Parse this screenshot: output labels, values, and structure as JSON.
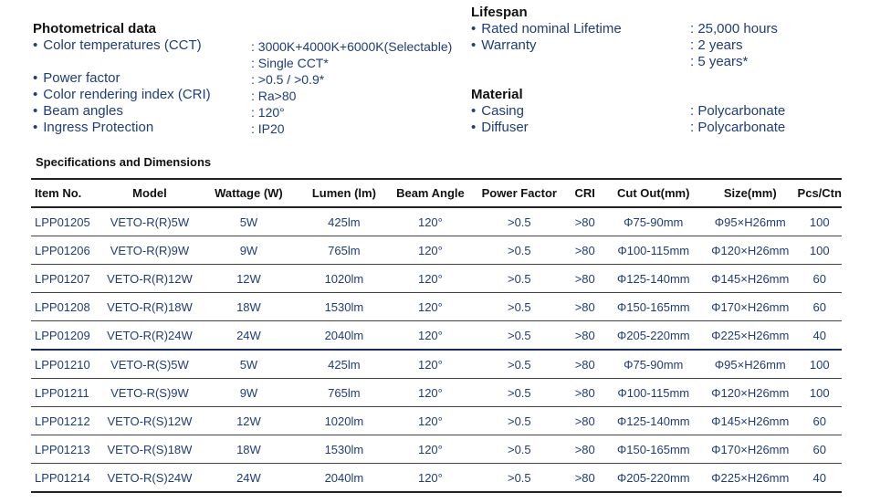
{
  "photometric": {
    "title": "Photometrical data",
    "items": [
      {
        "label": "Color temperatures (CCT)",
        "value": ": 3000K+4000K+6000K(Selectable)"
      },
      {
        "label": "",
        "value": ": Single CCT*"
      },
      {
        "label": "Power factor",
        "value": ": >0.5 / >0.9*"
      },
      {
        "label": "Color rendering index (CRI)",
        "value": ": Ra>80"
      },
      {
        "label": "Beam angles",
        "value": ": 120°"
      },
      {
        "label": "Ingress Protection",
        "value": ": IP20"
      }
    ]
  },
  "lifespan": {
    "title": "Lifespan",
    "items": [
      {
        "label": "Rated nominal Lifetime",
        "value": ": 25,000 hours"
      },
      {
        "label": "Warranty",
        "value": ": 2 years"
      },
      {
        "label": "",
        "value": ": 5 years*"
      }
    ]
  },
  "material": {
    "title": "Material",
    "items": [
      {
        "label": "Casing",
        "value": ": Polycarbonate"
      },
      {
        "label": "Diffuser",
        "value": ": Polycarbonate"
      }
    ]
  },
  "bullet": "•",
  "table": {
    "title": "Specifications and Dimensions",
    "headers": [
      "Item No.",
      "Model",
      "Wattage (W)",
      "Lumen (lm)",
      "Beam Angle",
      "Power Factor",
      "CRI",
      "Cut Out(mm)",
      "Size(mm)",
      "Pcs/Ctn"
    ],
    "rows": [
      [
        "LPP01205",
        "VETO-R(R)5W",
        "5W",
        "425lm",
        "120°",
        ">0.5",
        ">80",
        "Φ75-90mm",
        "Φ95×H26mm",
        "100"
      ],
      [
        "LPP01206",
        "VETO-R(R)9W",
        "9W",
        "765lm",
        "120°",
        ">0.5",
        ">80",
        "Φ100-115mm",
        "Φ120×H26mm",
        "100"
      ],
      [
        "LPP01207",
        "VETO-R(R)12W",
        "12W",
        "1020lm",
        "120°",
        ">0.5",
        ">80",
        "Φ125-140mm",
        "Φ145×H26mm",
        "60"
      ],
      [
        "LPP01208",
        "VETO-R(R)18W",
        "18W",
        "1530lm",
        "120°",
        ">0.5",
        ">80",
        "Φ150-165mm",
        "Φ170×H26mm",
        "60"
      ],
      [
        "LPP01209",
        "VETO-R(R)24W",
        "24W",
        "2040lm",
        "120°",
        ">0.5",
        ">80",
        "Φ205-220mm",
        "Φ225×H26mm",
        "40"
      ],
      [
        "LPP01210",
        "VETO-R(S)5W",
        "5W",
        "425lm",
        "120°",
        ">0.5",
        ">80",
        "Φ75-90mm",
        "Φ95×H26mm",
        "100"
      ],
      [
        "LPP01211",
        "VETO-R(S)9W",
        "9W",
        "765lm",
        "120°",
        ">0.5",
        ">80",
        "Φ100-115mm",
        "Φ120×H26mm",
        "100"
      ],
      [
        "LPP01212",
        "VETO-R(S)12W",
        "12W",
        "1020lm",
        "120°",
        ">0.5",
        ">80",
        "Φ125-140mm",
        "Φ145×H26mm",
        "60"
      ],
      [
        "LPP01213",
        "VETO-R(S)18W",
        "18W",
        "1530lm",
        "120°",
        ">0.5",
        ">80",
        "Φ150-165mm",
        "Φ170×H26mm",
        "60"
      ],
      [
        "LPP01214",
        "VETO-R(S)24W",
        "24W",
        "2040lm",
        "120°",
        ">0.5",
        ">80",
        "Φ205-220mm",
        "Φ225×H26mm",
        "40"
      ]
    ]
  }
}
